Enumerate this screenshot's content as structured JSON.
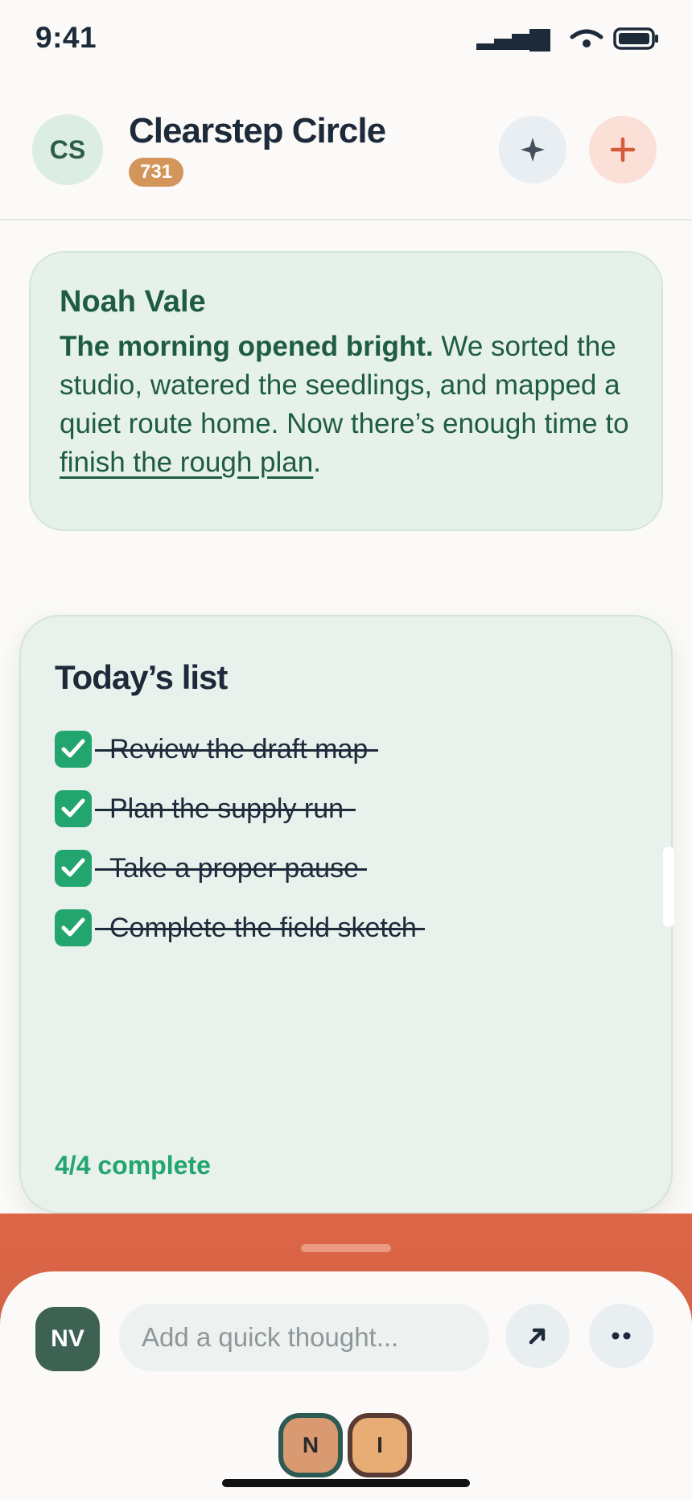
{
  "status_bar": {
    "time": "9:41"
  },
  "header": {
    "avatar_initials": "CS",
    "title": "Clearstep Circle",
    "badge_count": "731",
    "sparkle_icon": "sparkle-icon",
    "add_icon": "plus-icon"
  },
  "message": {
    "author": "Noah Vale",
    "bold_lead": "The morning opened bright.",
    "text": " We sorted the studio, watered the seedlings, and mapped a quiet route home. Now there’s enough time to ",
    "link": "finish the rough plan",
    "end": "."
  },
  "checklist": {
    "title": "Today’s list",
    "items": [
      {
        "label": "Review the draft map",
        "done": true
      },
      {
        "label": "Plan the supply run",
        "done": true
      },
      {
        "label": "Take a proper pause",
        "done": true
      },
      {
        "label": "Complete the field sketch",
        "done": true
      }
    ],
    "footer": "4/4 complete"
  },
  "composer": {
    "avatar_initials": "NV",
    "placeholder": "Add a quick thought...",
    "send_icon": "arrow-up-right-icon",
    "more_icon": "more-dots-icon"
  },
  "presence": [
    {
      "initial": "N"
    },
    {
      "initial": "I"
    }
  ],
  "colors": {
    "accent_green": "#22a56e",
    "dark_green": "#1f5c44",
    "coral": "#dd6646",
    "badge_orange": "#d39559"
  }
}
